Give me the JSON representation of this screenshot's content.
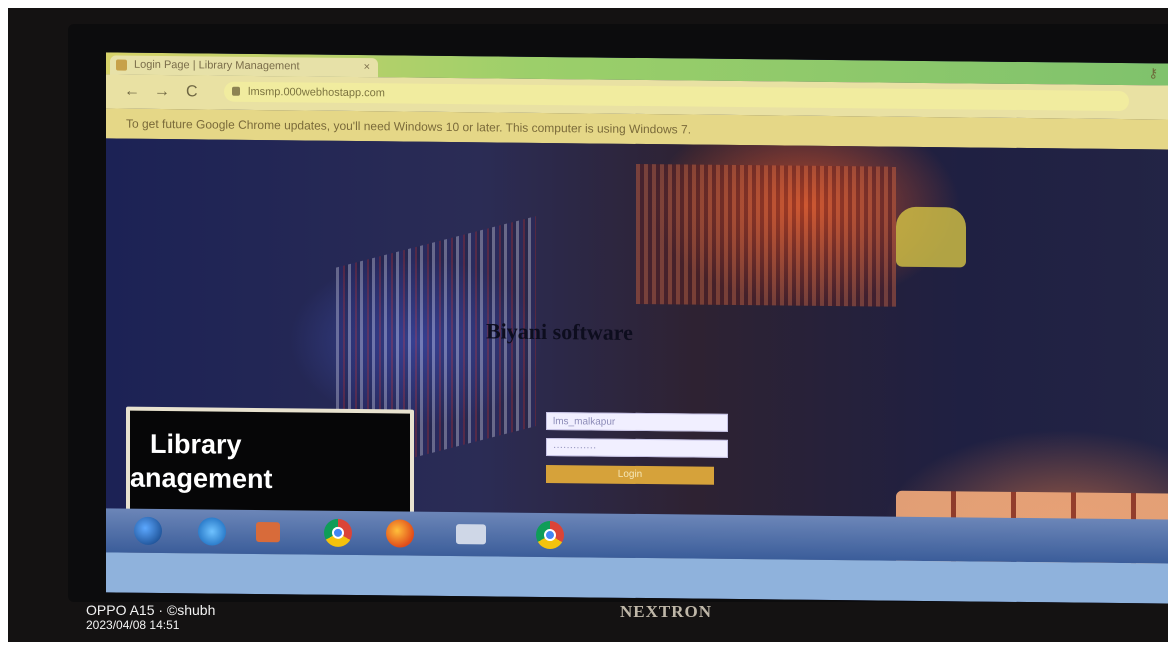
{
  "browser": {
    "tab_title": "Login Page | Library Management",
    "tab_close": "×",
    "back": "←",
    "forward": "→",
    "reload": "C",
    "url": "lmsmp.000webhostapp.com",
    "window_key_icon": "key-icon",
    "info_bar": "To get future Google Chrome updates, you'll need Windows 10 or later. This computer is using Windows 7."
  },
  "page": {
    "brand": "Biyani software",
    "username_value": "lms_malkapur",
    "password_value": "·············",
    "login_label": "Login",
    "logo_line1": "Library",
    "logo_line2": "anagement"
  },
  "taskbar": {
    "icons": [
      "windows-start-icon",
      "internet-explorer-icon",
      "media-player-icon",
      "chrome-icon",
      "firefox-icon",
      "folder-icon",
      "chrome-canary-icon"
    ]
  },
  "monitor": {
    "brand": "NEXTRON"
  },
  "photo_stamp": {
    "device": "OPPO A15 · ©shubh",
    "datetime": "2023/04/08 14:51"
  },
  "colors": {
    "login_button": "#d6a23a",
    "tab_bar": "#9ccf6a",
    "info_bar": "#e5d787"
  }
}
